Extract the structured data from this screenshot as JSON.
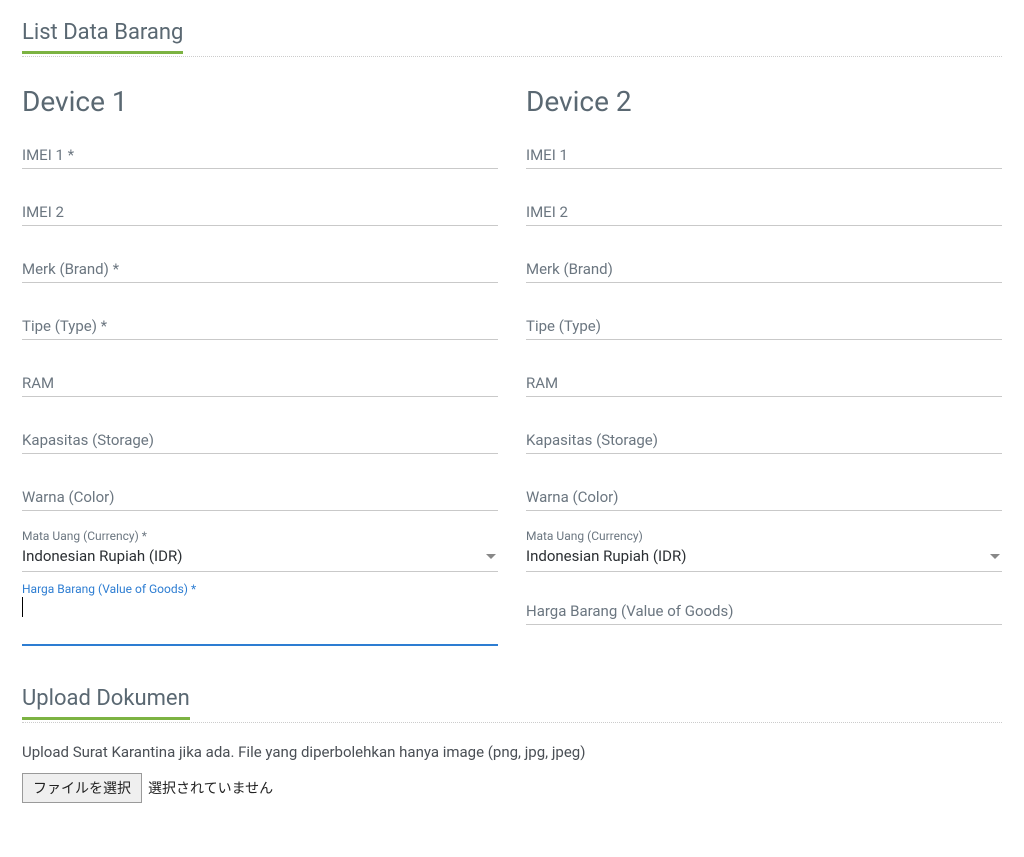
{
  "sections": {
    "list_data_barang": "List Data Barang",
    "upload_dokumen": "Upload Dokumen"
  },
  "devices": [
    {
      "heading": "Device 1",
      "fields": {
        "imei1_label": "IMEI 1 *",
        "imei2_label": "IMEI 2",
        "merk_label": "Merk (Brand) *",
        "tipe_label": "Tipe (Type) *",
        "ram_label": "RAM",
        "kapasitas_label": "Kapasitas (Storage)",
        "warna_label": "Warna (Color)",
        "currency_small_label": "Mata Uang (Currency) *",
        "currency_value": "Indonesian Rupiah (IDR)",
        "harga_label": "Harga Barang (Value of Goods) *"
      }
    },
    {
      "heading": "Device 2",
      "fields": {
        "imei1_label": "IMEI 1",
        "imei2_label": "IMEI 2",
        "merk_label": "Merk (Brand)",
        "tipe_label": "Tipe (Type)",
        "ram_label": "RAM",
        "kapasitas_label": "Kapasitas (Storage)",
        "warna_label": "Warna (Color)",
        "currency_small_label": "Mata Uang (Currency)",
        "currency_value": "Indonesian Rupiah (IDR)",
        "harga_label": "Harga Barang (Value of Goods)"
      }
    }
  ],
  "upload": {
    "description": "Upload Surat Karantina jika ada. File yang diperbolehkan hanya image (png, jpg, jpeg)",
    "button_label": "ファイルを選択",
    "status_text": "選択されていません"
  }
}
